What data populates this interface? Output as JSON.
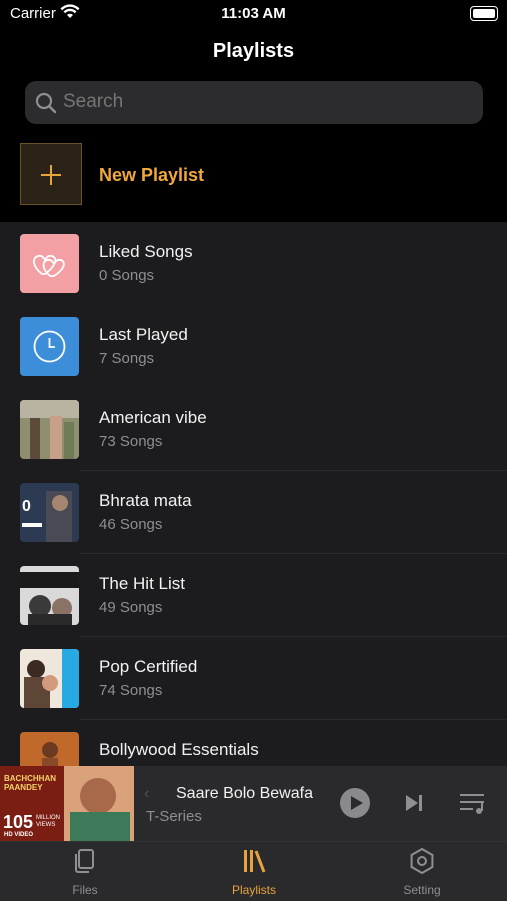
{
  "status": {
    "carrier": "Carrier",
    "time": "11:03 AM"
  },
  "title": "Playlists",
  "search": {
    "placeholder": "Search"
  },
  "new_playlist": {
    "label": "New Playlist"
  },
  "playlists": [
    {
      "name": "Liked Songs",
      "count": "0 Songs",
      "icon": "heart-icon"
    },
    {
      "name": "Last Played",
      "count": "7 Songs",
      "icon": "clock-icon"
    },
    {
      "name": "American vibe",
      "count": "73 Songs",
      "icon": "cover-art"
    },
    {
      "name": "Bhrata mata",
      "count": "46 Songs",
      "icon": "cover-art"
    },
    {
      "name": "The Hit List",
      "count": "49 Songs",
      "icon": "cover-art"
    },
    {
      "name": "Pop Certified",
      "count": "74 Songs",
      "icon": "cover-art"
    },
    {
      "name": "Bollywood Essentials",
      "count": "",
      "icon": "cover-art"
    }
  ],
  "now_playing": {
    "song": "Saare Bolo Bewafa",
    "artist": "T-Series",
    "art_text": {
      "views": "105",
      "views_label": "MILLION VIEWS",
      "title": "BACHCHHAN PAANDEY",
      "hd": "HD VIDEO"
    }
  },
  "tabs": [
    {
      "label": "Files",
      "icon": "files-icon",
      "active": false
    },
    {
      "label": "Playlists",
      "icon": "playlists-icon",
      "active": true
    },
    {
      "label": "Setting",
      "icon": "gear-icon",
      "active": false
    }
  ],
  "colors": {
    "accent": "#e8a33d",
    "background": "#1c1c1e",
    "liked_tile": "#f2a0a3",
    "last_played_tile": "#3d8ed8"
  }
}
